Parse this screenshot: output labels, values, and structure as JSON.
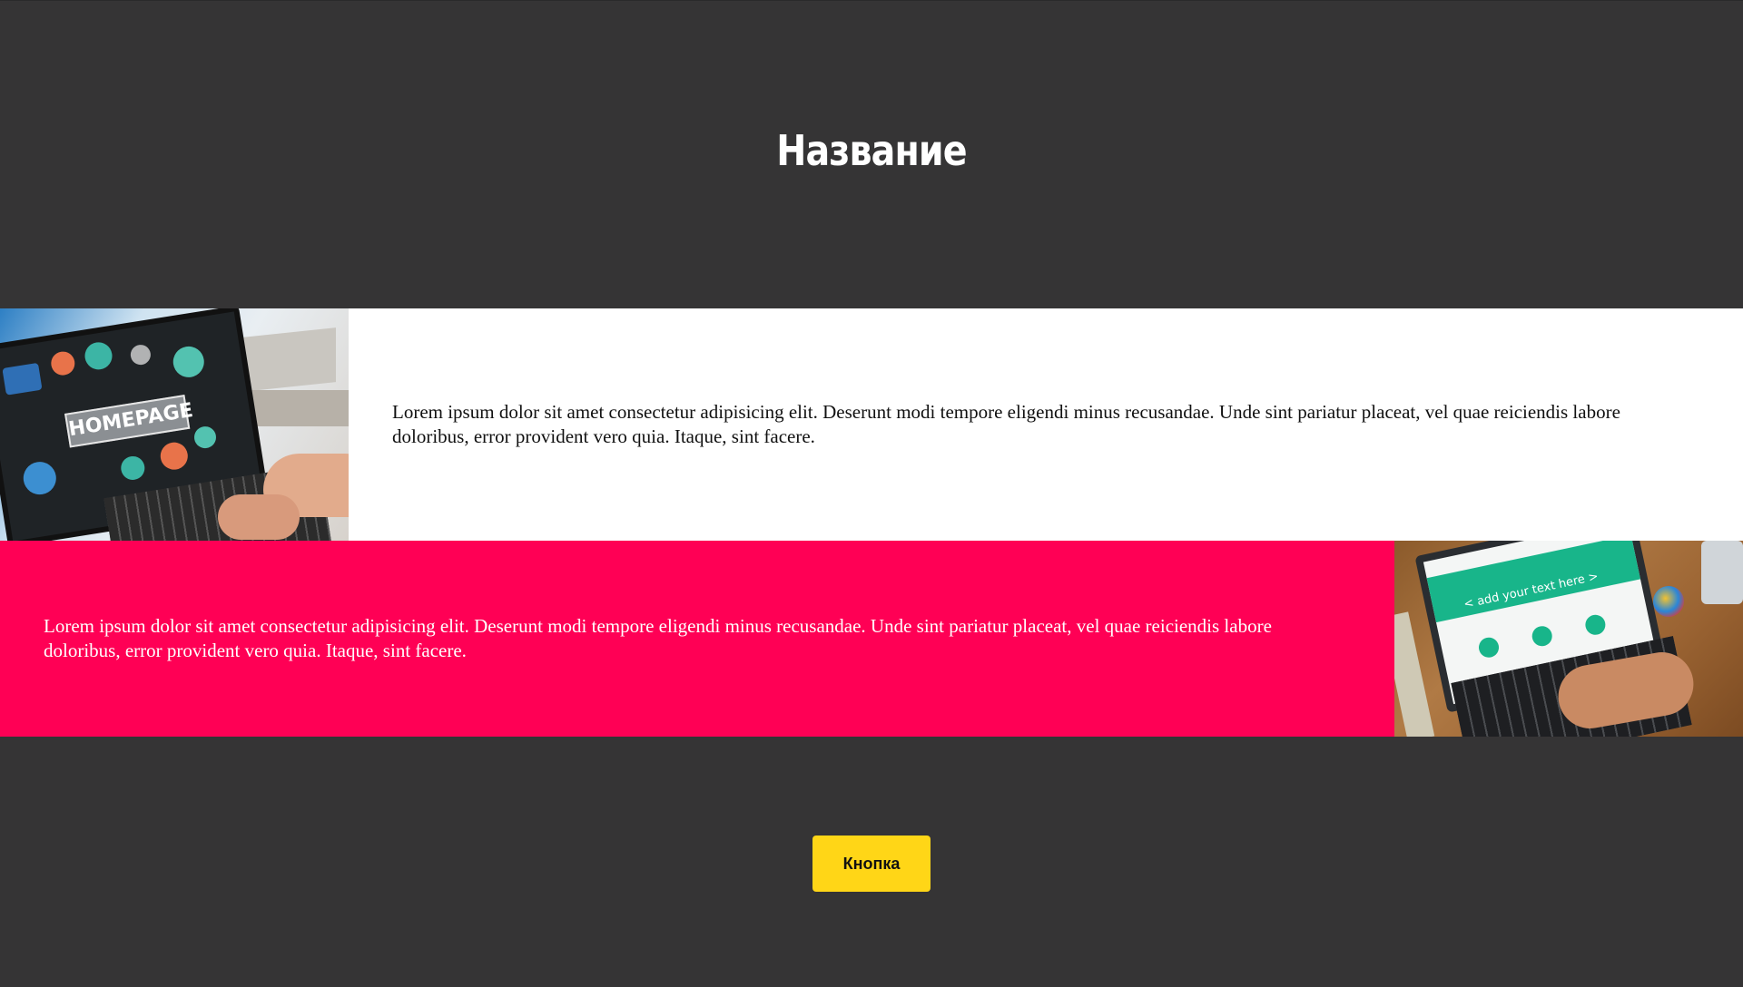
{
  "header": {
    "title": "Название"
  },
  "rows": [
    {
      "text": "Lorem ipsum dolor sit amet consectetur adipisicing elit. Deserunt modi tempore eligendi minus recusandae. Unde sint pariatur placeat, vel quae reiciendis labore doloribus, error provident vero quia. Itaque, sint facere.",
      "image": {
        "label": "HOMEPAGE"
      },
      "background": "#ffffff",
      "text_color": "#111111"
    },
    {
      "text": "Lorem ipsum dolor sit amet consectetur adipisicing elit. Deserunt modi tempore eligendi minus recusandae. Unde sint pariatur placeat, vel quae reiciendis labore doloribus, error provident vero quia. Itaque, sint facere.",
      "image": {
        "label": "< add your text here >"
      },
      "background": "#ff0055",
      "text_color": "#ffffff"
    }
  ],
  "footer": {
    "button_label": "Кнопка"
  },
  "colors": {
    "page_background": "#353435",
    "accent": "#ff0055",
    "button": "#ffd617"
  }
}
